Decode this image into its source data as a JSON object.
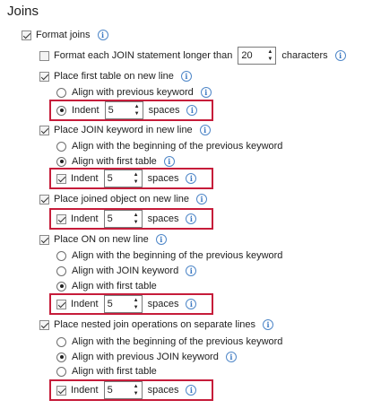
{
  "title": "Joins",
  "format_joins": {
    "label": "Format joins",
    "checked": true
  },
  "length": {
    "pre_label": "Format each JOIN statement longer than",
    "value": "20",
    "post_label": "characters",
    "checked": false
  },
  "first_table": {
    "label": "Place first table on new line",
    "checked": true,
    "align_prev": {
      "label": "Align with previous keyword",
      "selected": false
    },
    "indent": {
      "label": "Indent",
      "value": "5",
      "unit": "spaces",
      "selected": true
    }
  },
  "join_kw": {
    "label": "Place JOIN keyword in new line",
    "checked": true,
    "align_begin": {
      "label": "Align with the beginning of the previous keyword",
      "selected": false
    },
    "align_first": {
      "label": "Align with first table",
      "selected": true
    },
    "indent": {
      "label": "Indent",
      "value": "5",
      "unit": "spaces",
      "checked": true
    }
  },
  "joined_obj": {
    "label": "Place joined object on new line",
    "checked": true,
    "indent": {
      "label": "Indent",
      "value": "5",
      "unit": "spaces",
      "checked": true
    }
  },
  "on_line": {
    "label": "Place ON on new line",
    "checked": true,
    "align_begin": {
      "label": "Align with the beginning of the previous keyword",
      "selected": false
    },
    "align_join": {
      "label": "Align with JOIN keyword",
      "selected": false
    },
    "align_first": {
      "label": "Align with first table",
      "selected": true
    },
    "indent": {
      "label": "Indent",
      "value": "5",
      "unit": "spaces",
      "checked": true
    }
  },
  "nested": {
    "label": "Place nested join operations on separate lines",
    "checked": true,
    "align_begin": {
      "label": "Align with the beginning of the previous keyword",
      "selected": false
    },
    "align_prev_join": {
      "label": "Align with previous JOIN keyword",
      "selected": true
    },
    "align_first": {
      "label": "Align with first table",
      "selected": false
    },
    "indent": {
      "label": "Indent",
      "value": "5",
      "unit": "spaces",
      "checked": true
    }
  },
  "colors": {
    "highlight": "#c61c3a",
    "info": "#3b78c2"
  }
}
